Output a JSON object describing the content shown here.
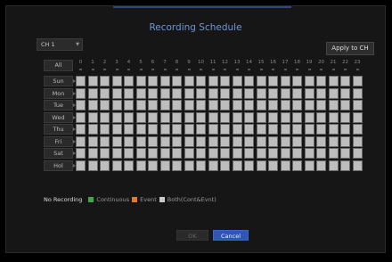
{
  "dialog": {
    "title": "Recording Schedule",
    "channel_select": "CH 1",
    "apply_button": "Apply to CH",
    "all_button": "All",
    "hours": [
      "0",
      "1",
      "2",
      "3",
      "4",
      "5",
      "6",
      "7",
      "8",
      "9",
      "10",
      "11",
      "12",
      "13",
      "14",
      "15",
      "16",
      "17",
      "18",
      "19",
      "20",
      "21",
      "22",
      "23"
    ],
    "days": [
      "Sun",
      "Mon",
      "Tue",
      "Wed",
      "Thu",
      "Fri",
      "Sat",
      "Hol"
    ],
    "legend": {
      "no_recording": "No Recording",
      "continuous": "Continuous",
      "event": "Event",
      "both": "Both(Cont&Evnt)"
    },
    "ok_button": "OK",
    "cancel_button": "Cancel"
  },
  "colors": {
    "continuous": "#3da745",
    "event": "#e07a2e",
    "both": "#c9c9c9",
    "cell_empty": "#bdbdbd",
    "title": "#6f95d6",
    "cancel_bg": "#2e56b6"
  }
}
